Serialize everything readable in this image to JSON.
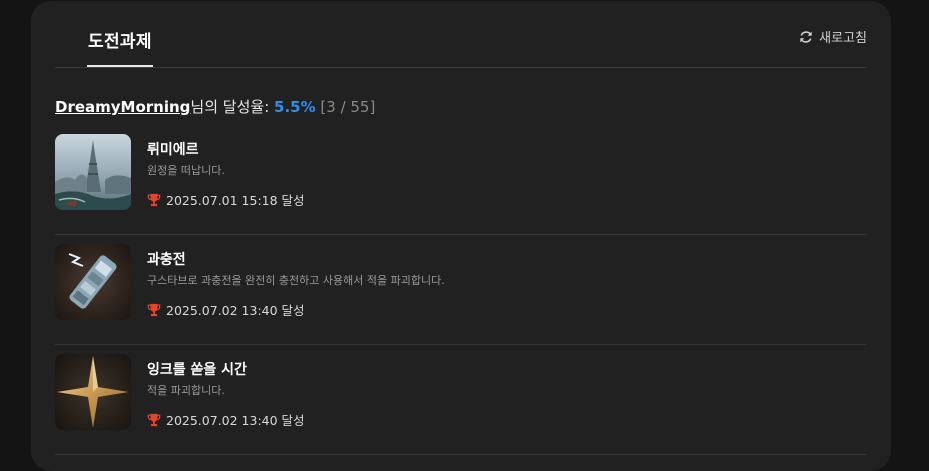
{
  "header": {
    "tab_label": "도전과제",
    "refresh_label": "새로고침"
  },
  "summary": {
    "username": "DreamyMorning",
    "suffix": "님의 달성율: ",
    "rate": "5.5%",
    "count": "[3 / 55]"
  },
  "achievements": [
    {
      "title": "뤼미에르",
      "description": "원정을 떠납니다.",
      "date": "2025.07.01 15:18 달성",
      "icon": "eiffel-tower-scene"
    },
    {
      "title": "과충전",
      "description": "구스타브로 과충전을 완전히 충전하고 사용해서 적을 파괴합니다.",
      "date": "2025.07.02 13:40 달성",
      "icon": "gauntlet-weapon"
    },
    {
      "title": "잉크를 쏟을 시간",
      "description": "적을 파괴합니다.",
      "date": "2025.07.02 13:40 달성",
      "icon": "gold-star"
    }
  ],
  "colors": {
    "accent": "#2f8cf0",
    "trophy": "#e8442c",
    "panel": "#212121"
  }
}
